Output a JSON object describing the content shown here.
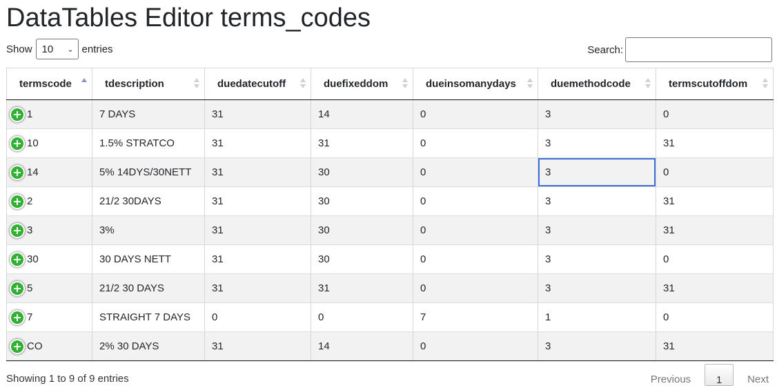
{
  "page": {
    "title": "DataTables Editor terms_codes"
  },
  "length": {
    "show_label": "Show",
    "value": "10",
    "entries_label": "entries"
  },
  "search": {
    "label": "Search:",
    "value": ""
  },
  "table": {
    "columns": [
      "termscode",
      "tdescription",
      "duedatecutoff",
      "duefixeddom",
      "dueinsomanydays",
      "duemethodcode",
      "termscutoffdom"
    ],
    "sorted_column": "termscode",
    "sort_direction": "ascending",
    "focused_cell": {
      "row": 2,
      "column": "duemethodcode"
    },
    "expand_icon": "plus-circle-icon",
    "expand_color": "#31b131",
    "rows": [
      [
        "1",
        "7 DAYS",
        "31",
        "14",
        "0",
        "3",
        "0"
      ],
      [
        "10",
        "1.5% STRATCO",
        "31",
        "31",
        "0",
        "3",
        "31"
      ],
      [
        "14",
        "5% 14DYS/30NETT",
        "31",
        "30",
        "0",
        "3",
        "0"
      ],
      [
        "2",
        "21/2 30DAYS",
        "31",
        "30",
        "0",
        "3",
        "31"
      ],
      [
        "3",
        "3%",
        "31",
        "30",
        "0",
        "3",
        "31"
      ],
      [
        "30",
        "30 DAYS NETT",
        "31",
        "30",
        "0",
        "3",
        "0"
      ],
      [
        "5",
        "21/2 30 DAYS",
        "31",
        "31",
        "0",
        "3",
        "31"
      ],
      [
        "7",
        "STRAIGHT 7 DAYS",
        "0",
        "0",
        "7",
        "1",
        "0"
      ],
      [
        "CO",
        "2% 30 DAYS",
        "31",
        "14",
        "0",
        "3",
        "31"
      ]
    ]
  },
  "info": "Showing 1 to 9 of 9 entries",
  "pagination": {
    "previous": "Previous",
    "current": "1",
    "next": "Next"
  }
}
